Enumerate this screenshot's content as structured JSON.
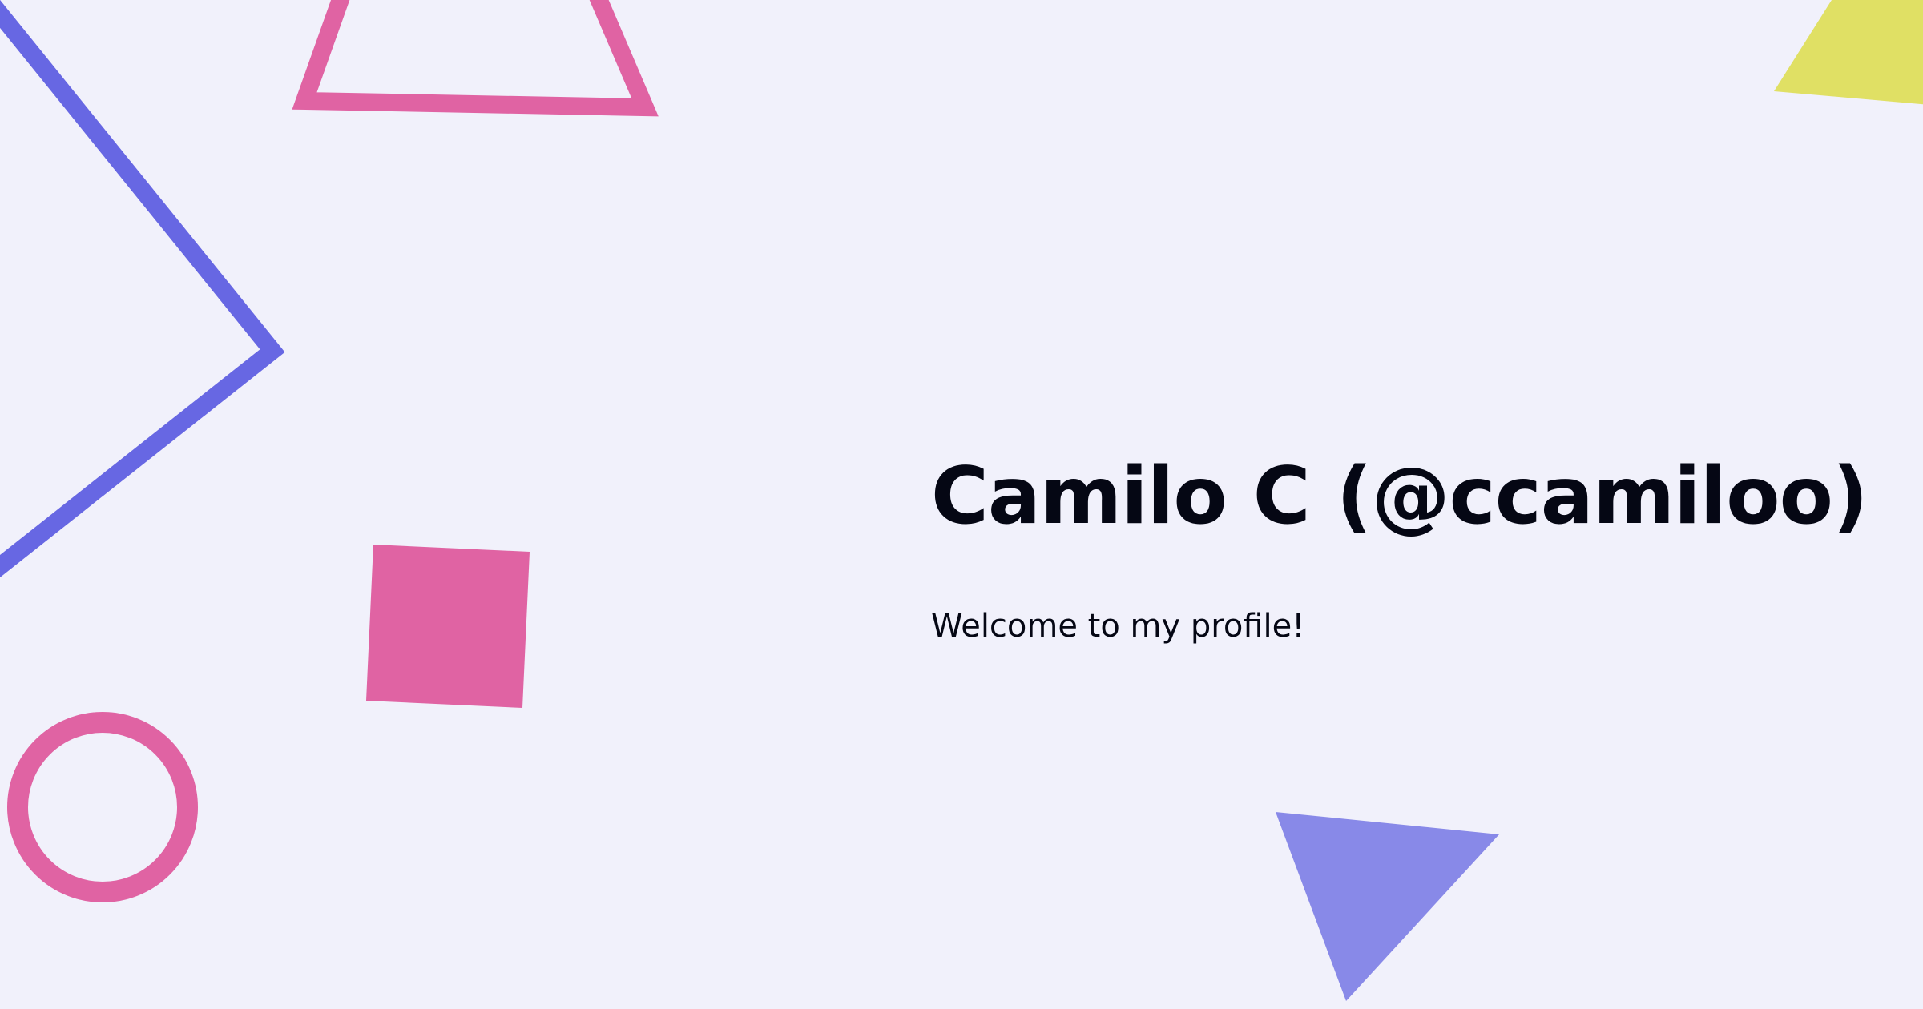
{
  "profile": {
    "display_name": "Camilo C (@ccamiloo)",
    "tagline": "Welcome to my profile!"
  },
  "colors": {
    "background": "#f1f1fb",
    "text": "#050714",
    "indigo": "#6767e3",
    "pink": "#e063a3",
    "lavender": "#8889e8",
    "yellow": "#e0e064"
  }
}
